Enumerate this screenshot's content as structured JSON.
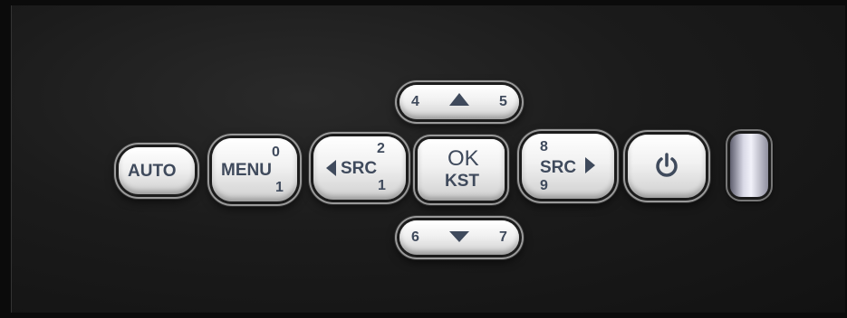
{
  "buttons": {
    "auto": {
      "label": "AUTO"
    },
    "menu": {
      "label": "MENU",
      "num_top": "0",
      "num_bottom": "1"
    },
    "src_left": {
      "label": "SRC",
      "num_top": "2",
      "num_bottom": "1"
    },
    "ok": {
      "label": "OK",
      "sub_label": "KST"
    },
    "src_right": {
      "label": "SRC",
      "num_top": "8",
      "num_bottom": "9"
    },
    "up": {
      "num_left": "4",
      "num_right": "5"
    },
    "down": {
      "num_left": "6",
      "num_right": "7"
    },
    "power": {
      "icon": "power-icon"
    }
  },
  "colors": {
    "panel": "#1b1b1b",
    "button_face": "#f1f1f1",
    "label_text": "#3f4a5c"
  }
}
